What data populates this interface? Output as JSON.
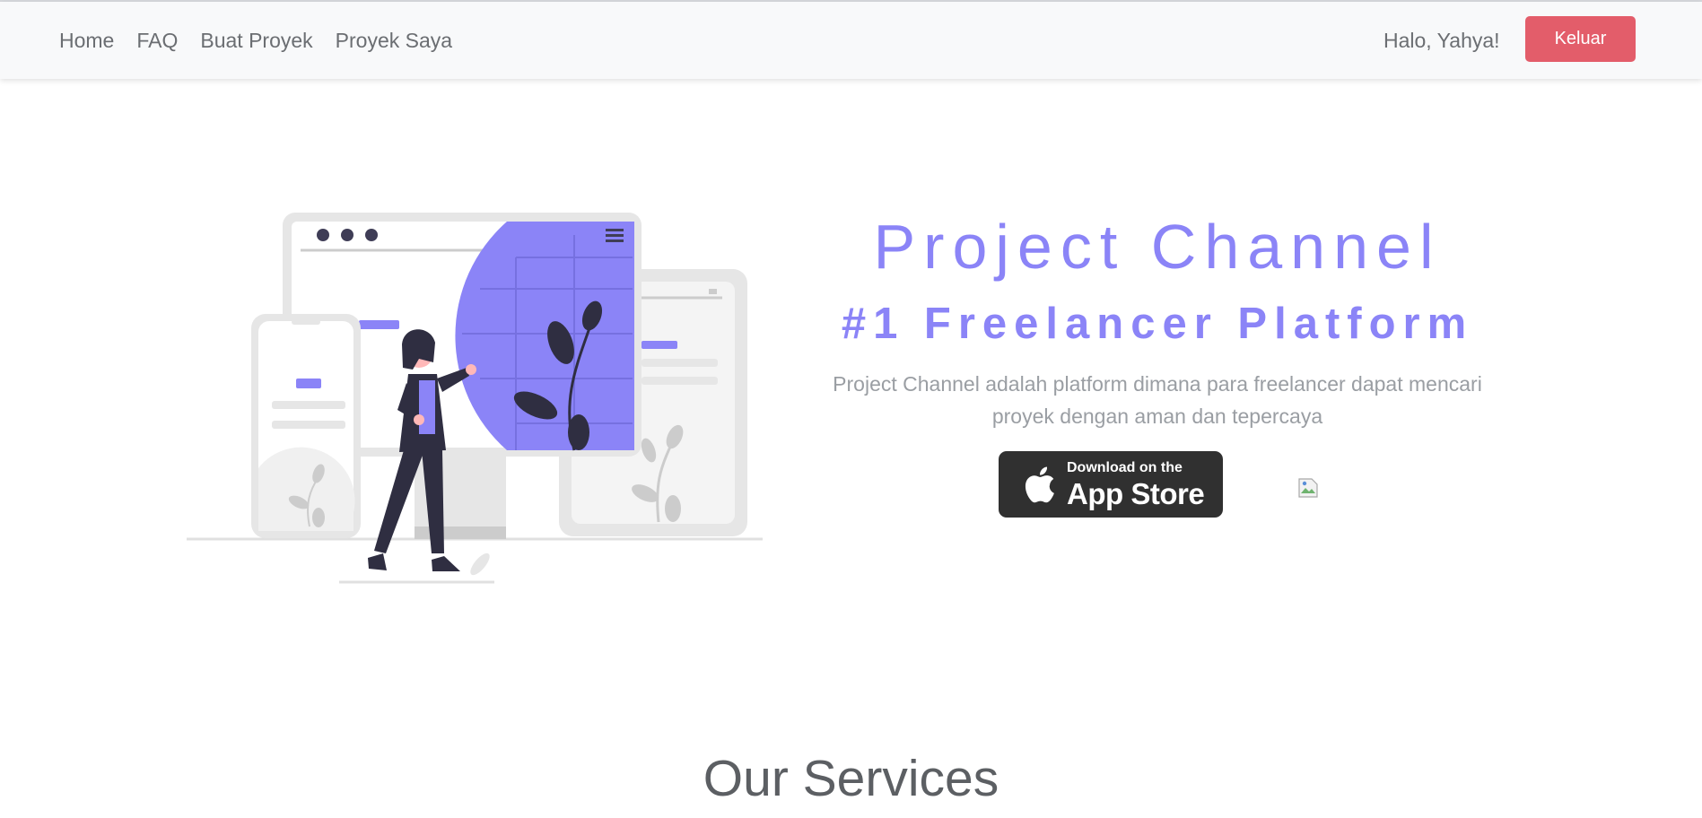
{
  "nav": {
    "links": [
      "Home",
      "FAQ",
      "Buat Proyek",
      "Proyek Saya"
    ],
    "greeting": "Halo, Yahya!",
    "logout_label": "Keluar"
  },
  "hero": {
    "title": "Project Channel",
    "subtitle": "#1 Freelancer Platform",
    "description": "Project Channel adalah platform dimana para freelancer dapat mencari proyek dengan aman dan tepercaya",
    "appstore_small": "Download on the",
    "appstore_big": "App Store"
  },
  "services": {
    "title": "Our Services"
  },
  "colors": {
    "accent": "#8b84f7",
    "logout": "#e35d6a",
    "navbar": "#f8f9fa"
  },
  "icons": [
    "apple-icon",
    "broken-image-icon",
    "hamburger-icon"
  ]
}
